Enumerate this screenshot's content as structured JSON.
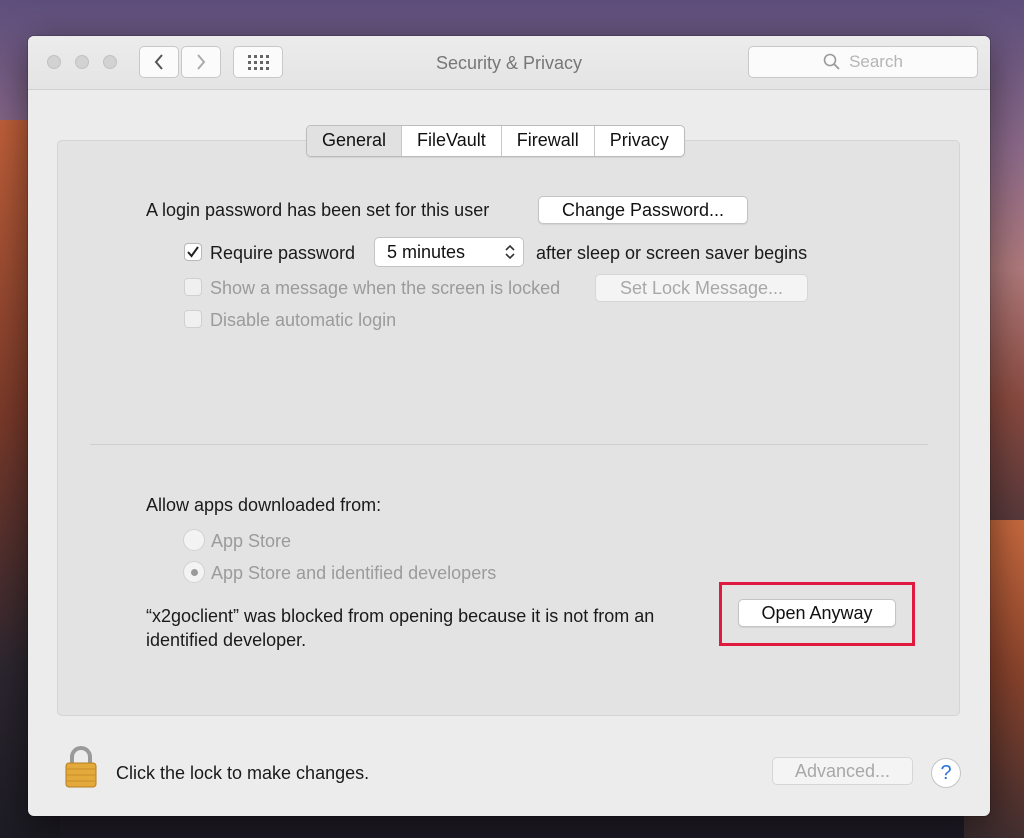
{
  "window": {
    "title": "Security & Privacy",
    "search_placeholder": "Search"
  },
  "tabs": [
    {
      "label": "General",
      "active": true
    },
    {
      "label": "FileVault",
      "active": false
    },
    {
      "label": "Firewall",
      "active": false
    },
    {
      "label": "Privacy",
      "active": false
    }
  ],
  "general": {
    "login_password_text": "A login password has been set for this user",
    "change_password_label": "Change Password...",
    "require_password_label": "Require password",
    "require_password_checked": true,
    "require_password_delay": "5 minutes",
    "after_sleep_text": "after sleep or screen saver begins",
    "show_message_label": "Show a message when the screen is locked",
    "set_lock_message_label": "Set Lock Message...",
    "disable_auto_login_label": "Disable automatic login"
  },
  "gatekeeper": {
    "allow_apps_label": "Allow apps downloaded from:",
    "options": [
      {
        "label": "App Store",
        "selected": false
      },
      {
        "label": "App Store and identified developers",
        "selected": true
      }
    ],
    "blocked_message_line1": "“x2goclient” was blocked from opening because it is not from an",
    "blocked_message_line2": "identified developer.",
    "open_anyway_label": "Open Anyway"
  },
  "footer": {
    "lock_text": "Click the lock to make changes.",
    "advanced_label": "Advanced...",
    "help_label": "?"
  },
  "colors": {
    "highlight": "#e0193f",
    "help_accent": "#2a74d8",
    "lock_gold": "#e3a93a"
  },
  "icons": [
    "chevron-left-icon",
    "chevron-right-icon",
    "grid-icon",
    "search-icon",
    "checkmark-icon",
    "stepper-arrows-icon",
    "lock-icon"
  ]
}
